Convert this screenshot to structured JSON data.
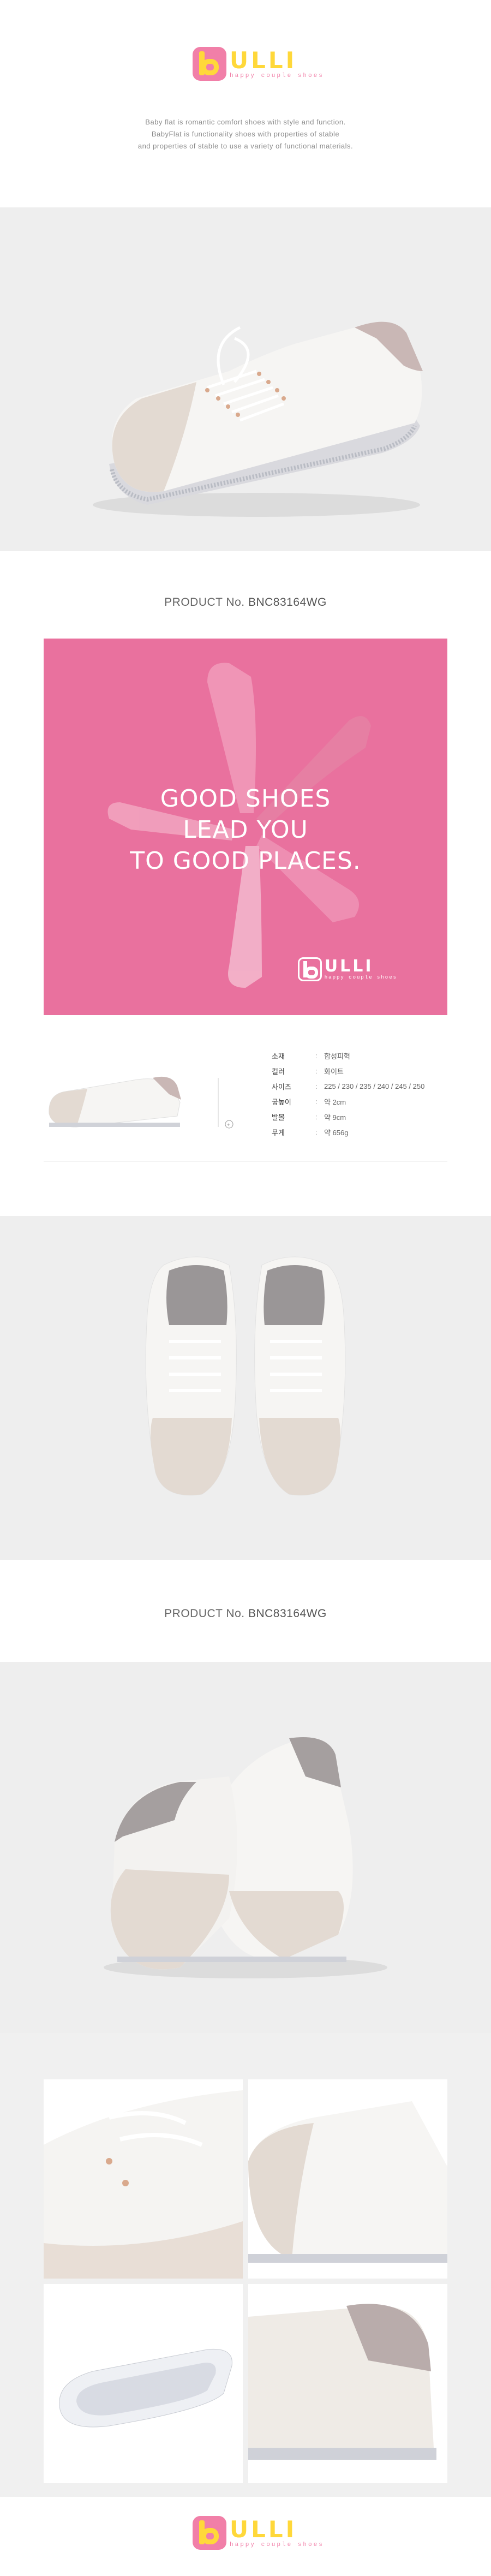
{
  "brand": {
    "wordmark": "ULLI",
    "tagline": "happy couple shoes"
  },
  "intro": {
    "line1": "Baby flat is romantic comfort shoes with style and function.",
    "line2": "BabyFlat is functionality shoes with properties of stable",
    "line3": "and properties of stable to use a variety of functional materials."
  },
  "product": {
    "label": "PRODUCT No.",
    "code": "BNC83164WG"
  },
  "promo": {
    "line1": "GOOD SHOES",
    "line2": "LEAD YOU",
    "line3": "TO GOOD PLACES.",
    "logo_word": "ULLI",
    "logo_tag": "happy couple shoes"
  },
  "specs": [
    {
      "key": "소재",
      "value": "합성피혁"
    },
    {
      "key": "컬러",
      "value": "화이트"
    },
    {
      "key": "사이즈",
      "value": "225 / 230 / 235 / 240 / 245 / 250"
    },
    {
      "key": "굽높이",
      "value": "약 2cm"
    },
    {
      "key": "발볼",
      "value": "약 9cm"
    },
    {
      "key": "무게",
      "value": "약 656g"
    }
  ],
  "colors": {
    "brand_pink": "#f17fa8",
    "brand_yellow": "#ffd83a",
    "promo_pink": "#e9719e",
    "band_gray": "#eeeeee"
  }
}
